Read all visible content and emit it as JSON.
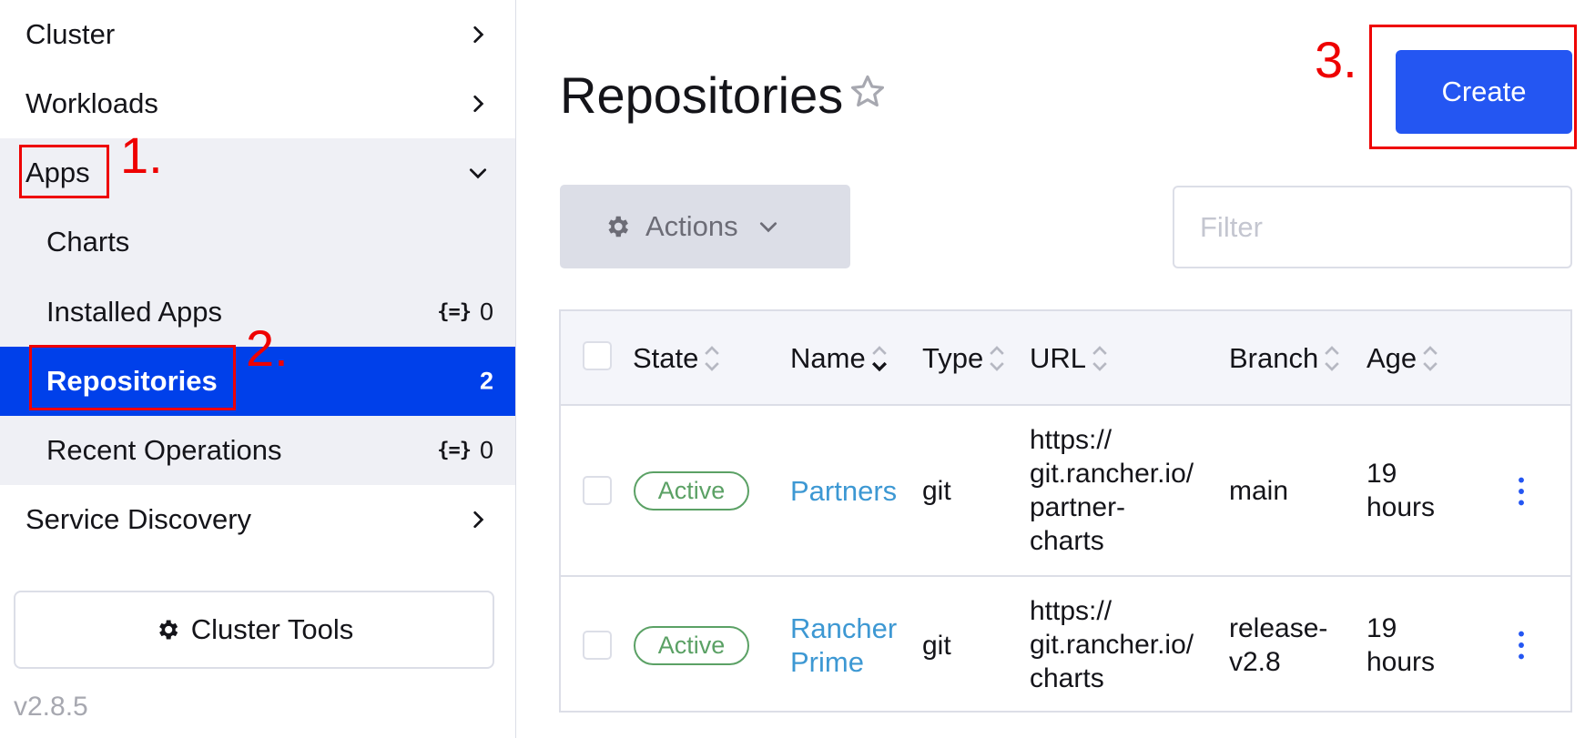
{
  "sidebar": {
    "groups": [
      {
        "label": "Cluster"
      },
      {
        "label": "Workloads"
      },
      {
        "label": "Apps"
      },
      {
        "label": "Service Discovery"
      }
    ],
    "apps_children": [
      {
        "label": "Charts",
        "count": ""
      },
      {
        "label": "Installed Apps",
        "count": "0"
      },
      {
        "label": "Repositories",
        "count": "2"
      },
      {
        "label": "Recent Operations",
        "count": "0"
      }
    ],
    "cluster_tools_label": "Cluster Tools",
    "version": "v2.8.5"
  },
  "main": {
    "title": "Repositories",
    "create_label": "Create",
    "actions_label": "Actions",
    "filter_placeholder": "Filter",
    "table": {
      "headers": [
        "State",
        "Name",
        "Type",
        "URL",
        "Branch",
        "Age"
      ],
      "rows": [
        {
          "state": "Active",
          "name": "Partners",
          "type": "git",
          "url": [
            "https://",
            "git.rancher.io/",
            "partner-",
            "charts"
          ],
          "branch": [
            "main"
          ],
          "age": [
            "19",
            "hours"
          ]
        },
        {
          "state": "Active",
          "name": [
            "Rancher",
            "Prime"
          ],
          "type": "git",
          "url": [
            "https://",
            "git.rancher.io/",
            "charts"
          ],
          "branch": [
            "release-",
            "v2.8"
          ],
          "age": [
            "19",
            "hours"
          ]
        }
      ]
    }
  },
  "annotations": [
    "1.",
    "2.",
    "3."
  ],
  "colors": {
    "active_nav": "#0040ea",
    "create_button": "#2456f2",
    "link": "#3d98d3",
    "active_badge": "#5ba165",
    "annotation": "#ee0000"
  },
  "icons": {
    "chevron_right": "chevron-right-icon",
    "chevron_down": "chevron-down-icon",
    "star": "star-icon",
    "gear": "gear-icon",
    "namespace": "namespace-icon",
    "sort": "sort-icon",
    "kebab": "kebab-menu-icon"
  }
}
